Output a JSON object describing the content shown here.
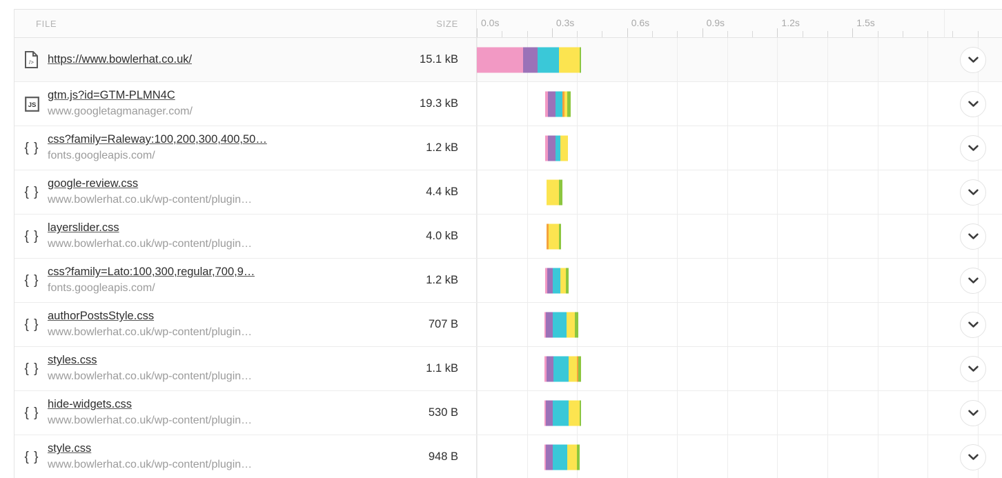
{
  "table": {
    "columns": {
      "file": "FILE",
      "size": "SIZE"
    },
    "timeline": {
      "labels": [
        "0.0s",
        "0.3s",
        "0.6s",
        "0.9s",
        "1.2s",
        "1.5s"
      ],
      "tick_values": [
        0.0,
        0.3,
        0.6,
        0.9,
        1.2,
        1.5
      ],
      "minor_tick_count": 21,
      "axis_min": 0.0,
      "axis_max": 2.1
    },
    "colors": {
      "blocked": "#f299c4",
      "dns": "#9b72b8",
      "connect": "#3ac8d8",
      "ssl": "#f5a33c",
      "wait": "#fce450",
      "receive": "#8cc63f",
      "row_border": "#ececec",
      "header_text": "#b3b3b3",
      "host_text": "#9b9b9b"
    },
    "rows": [
      {
        "icon": "html-file-icon",
        "name": "https://www.bowlerhat.co.uk/",
        "host": "",
        "size": "15.1 kB",
        "highlighted": true,
        "expand_label": "chevron-down-icon",
        "bar": {
          "start": 0.0,
          "segments": [
            {
              "type": "blocked",
              "color": "#f299c4",
              "dur": 0.185
            },
            {
              "type": "dns",
              "color": "#9b72b8",
              "dur": 0.058
            },
            {
              "type": "connect",
              "color": "#3ac8d8",
              "dur": 0.085
            },
            {
              "type": "wait",
              "color": "#fce450",
              "dur": 0.082
            },
            {
              "type": "receive",
              "color": "#8cc63f",
              "dur": 0.007
            }
          ]
        }
      },
      {
        "icon": "js-file-icon",
        "name": "gtm.js?id=GTM-PLMN4C",
        "host": "www.googletagmanager.com/",
        "size": "19.3 kB",
        "highlighted": false,
        "expand_label": "chevron-down-icon",
        "bar": {
          "start": 0.273,
          "segments": [
            {
              "type": "blocked",
              "color": "#f299c4",
              "dur": 0.012
            },
            {
              "type": "dns",
              "color": "#9b72b8",
              "dur": 0.028
            },
            {
              "type": "connect",
              "color": "#3ac8d8",
              "dur": 0.029
            },
            {
              "type": "ssl",
              "color": "#f5a33c",
              "dur": 0.008
            },
            {
              "type": "wait",
              "color": "#fce450",
              "dur": 0.012
            },
            {
              "type": "receive",
              "color": "#8cc63f",
              "dur": 0.012
            }
          ]
        }
      },
      {
        "icon": "css-file-icon",
        "name": "css?family=Raleway:100,200,300,400,50…",
        "host": "fonts.googleapis.com/",
        "size": "1.2 kB",
        "highlighted": false,
        "expand_label": "chevron-down-icon",
        "bar": {
          "start": 0.273,
          "segments": [
            {
              "type": "blocked",
              "color": "#f299c4",
              "dur": 0.01
            },
            {
              "type": "dns",
              "color": "#9b72b8",
              "dur": 0.03
            },
            {
              "type": "connect",
              "color": "#3ac8d8",
              "dur": 0.021
            },
            {
              "type": "wait",
              "color": "#fce450",
              "dur": 0.031
            }
          ]
        }
      },
      {
        "icon": "css-file-icon",
        "name": "google-review.css",
        "host": "www.bowlerhat.co.uk/wp-content/plugin…",
        "size": "4.4 kB",
        "highlighted": false,
        "expand_label": "chevron-down-icon",
        "bar": {
          "start": 0.277,
          "segments": [
            {
              "type": "wait",
              "color": "#fce450",
              "dur": 0.052
            },
            {
              "type": "receive",
              "color": "#8cc63f",
              "dur": 0.012
            }
          ]
        }
      },
      {
        "icon": "css-file-icon",
        "name": "layerslider.css",
        "host": "www.bowlerhat.co.uk/wp-content/plugin…",
        "size": "4.0 kB",
        "highlighted": false,
        "expand_label": "chevron-down-icon",
        "bar": {
          "start": 0.277,
          "segments": [
            {
              "type": "ssl",
              "color": "#f5a33c",
              "dur": 0.009
            },
            {
              "type": "wait",
              "color": "#fce450",
              "dur": 0.042
            },
            {
              "type": "receive",
              "color": "#8cc63f",
              "dur": 0.009
            }
          ]
        }
      },
      {
        "icon": "css-file-icon",
        "name": "css?family=Lato:100,300,regular,700,9…",
        "host": "fonts.googleapis.com/",
        "size": "1.2 kB",
        "highlighted": false,
        "expand_label": "chevron-down-icon",
        "bar": {
          "start": 0.272,
          "segments": [
            {
              "type": "blocked",
              "color": "#f299c4",
              "dur": 0.008
            },
            {
              "type": "dns",
              "color": "#9b72b8",
              "dur": 0.023
            },
            {
              "type": "connect",
              "color": "#3ac8d8",
              "dur": 0.031
            },
            {
              "type": "wait",
              "color": "#fce450",
              "dur": 0.021
            },
            {
              "type": "receive",
              "color": "#8cc63f",
              "dur": 0.012
            }
          ]
        }
      },
      {
        "icon": "css-file-icon",
        "name": "authorPostsStyle.css",
        "host": "www.bowlerhat.co.uk/wp-content/plugin…",
        "size": "707 B",
        "highlighted": false,
        "expand_label": "chevron-down-icon",
        "bar": {
          "start": 0.27,
          "segments": [
            {
              "type": "blocked",
              "color": "#f299c4",
              "dur": 0.006
            },
            {
              "type": "dns",
              "color": "#9b72b8",
              "dur": 0.026
            },
            {
              "type": "connect",
              "color": "#3ac8d8",
              "dur": 0.055
            },
            {
              "type": "wait",
              "color": "#fce450",
              "dur": 0.035
            },
            {
              "type": "receive",
              "color": "#8cc63f",
              "dur": 0.013
            }
          ]
        }
      },
      {
        "icon": "css-file-icon",
        "name": "styles.css",
        "host": "www.bowlerhat.co.uk/wp-content/plugin…",
        "size": "1.1 kB",
        "highlighted": false,
        "expand_label": "chevron-down-icon",
        "bar": {
          "start": 0.271,
          "segments": [
            {
              "type": "blocked",
              "color": "#f299c4",
              "dur": 0.006
            },
            {
              "type": "dns",
              "color": "#9b72b8",
              "dur": 0.029
            },
            {
              "type": "connect",
              "color": "#3ac8d8",
              "dur": 0.06
            },
            {
              "type": "wait",
              "color": "#fce450",
              "dur": 0.035
            },
            {
              "type": "ssl",
              "color": "#f5a33c",
              "dur": 0.005
            },
            {
              "type": "receive",
              "color": "#8cc63f",
              "dur": 0.01
            }
          ]
        }
      },
      {
        "icon": "css-file-icon",
        "name": "hide-widgets.css",
        "host": "www.bowlerhat.co.uk/wp-content/plugin…",
        "size": "530 B",
        "highlighted": false,
        "expand_label": "chevron-down-icon",
        "bar": {
          "start": 0.27,
          "segments": [
            {
              "type": "blocked",
              "color": "#f299c4",
              "dur": 0.005
            },
            {
              "type": "dns",
              "color": "#9b72b8",
              "dur": 0.028
            },
            {
              "type": "connect",
              "color": "#3ac8d8",
              "dur": 0.063
            },
            {
              "type": "wait",
              "color": "#fce450",
              "dur": 0.043
            },
            {
              "type": "receive",
              "color": "#8cc63f",
              "dur": 0.006
            }
          ]
        }
      },
      {
        "icon": "css-file-icon",
        "name": "style.css",
        "host": "www.bowlerhat.co.uk/wp-content/plugin…",
        "size": "948 B",
        "highlighted": false,
        "expand_label": "chevron-down-icon",
        "bar": {
          "start": 0.27,
          "segments": [
            {
              "type": "blocked",
              "color": "#f299c4",
              "dur": 0.005
            },
            {
              "type": "dns",
              "color": "#9b72b8",
              "dur": 0.028
            },
            {
              "type": "connect",
              "color": "#3ac8d8",
              "dur": 0.058
            },
            {
              "type": "wait",
              "color": "#fce450",
              "dur": 0.038
            },
            {
              "type": "receive",
              "color": "#8cc63f",
              "dur": 0.011
            }
          ]
        }
      }
    ]
  }
}
